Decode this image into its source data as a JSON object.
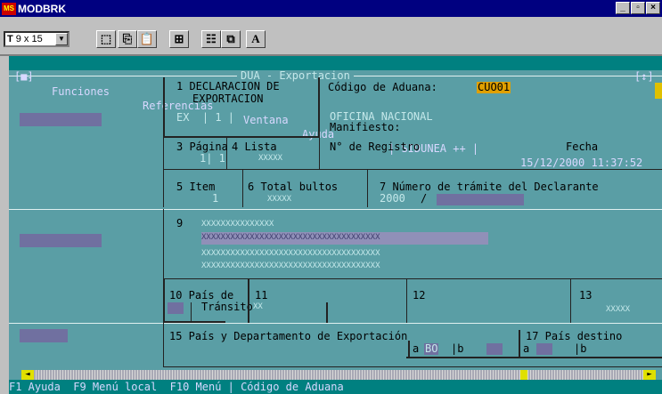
{
  "window": {
    "title": "MODBRK",
    "icon": "app-icon",
    "controls": [
      "_",
      "▫",
      "×"
    ]
  },
  "toolbar": {
    "font_size": "9 x 15",
    "bold_label": "A"
  },
  "menu": {
    "items": [
      "Funciones",
      "Referencias",
      "Ventana",
      "Ayuda"
    ],
    "system": "SIDUNEA ++",
    "datetime": "15/12/2000 11:37:52",
    "dash": "-"
  },
  "form": {
    "title": "DUA - Exportacion",
    "box1_line1": "1 DECLARACION DE",
    "box1_line2": "EXPORTACION",
    "box1_value": "EX  | 1 |",
    "aduana_label": "Código de Aduana:",
    "aduana_value": "CUO01",
    "oficina": "OFICINA NACIONAL",
    "manifiesto": "Manifiesto:",
    "pagina_label": "3 Página",
    "pagina_value": "1| 1",
    "lista_label": "4 Lista",
    "lista_value": "XXXXX",
    "registro_label": "N° de Registro",
    "fecha_label": "Fecha",
    "item_label": "5 Item",
    "item_value": "1",
    "bultos_label": "6 Total bultos",
    "bultos_value": "XXXXX",
    "tramite_label": "7 Número de trámite del Declarante",
    "tramite_year": "2000",
    "tramite_slash": "/",
    "box9_label": "9",
    "box9_line1": "XXXXXXXXXXXXXXX",
    "box9_line2": "XXXXXXXXXXXXXXXXXXXXXXXXXXXXXXXXXXXXX",
    "box9_line3": "XXXXXXXXXXXXXXXXXXXXXXXXXXXXXXXXXXXXX",
    "box9_line4": "XXXXXXXXXXXXXXXXXXXXXXXXXXXXXXXXXXXXX",
    "box10_label": "10 País de",
    "box10_sub": "Tránsito",
    "box11_label": "11",
    "box11_value": "XX",
    "box12_label": "12",
    "box13_label": "13",
    "box13_value": "XXXXX",
    "box15_label": "15 País y Departamento de Exportación",
    "box15_a": "a",
    "box15_a_val": "BO",
    "box15_b": "|b",
    "box17_label": "17 País destino",
    "box17_a": "a",
    "box17_b": "|b"
  },
  "status": {
    "text": "F1 Ayuda  F9 Menú local  F10 Menú | Código de Aduana"
  }
}
